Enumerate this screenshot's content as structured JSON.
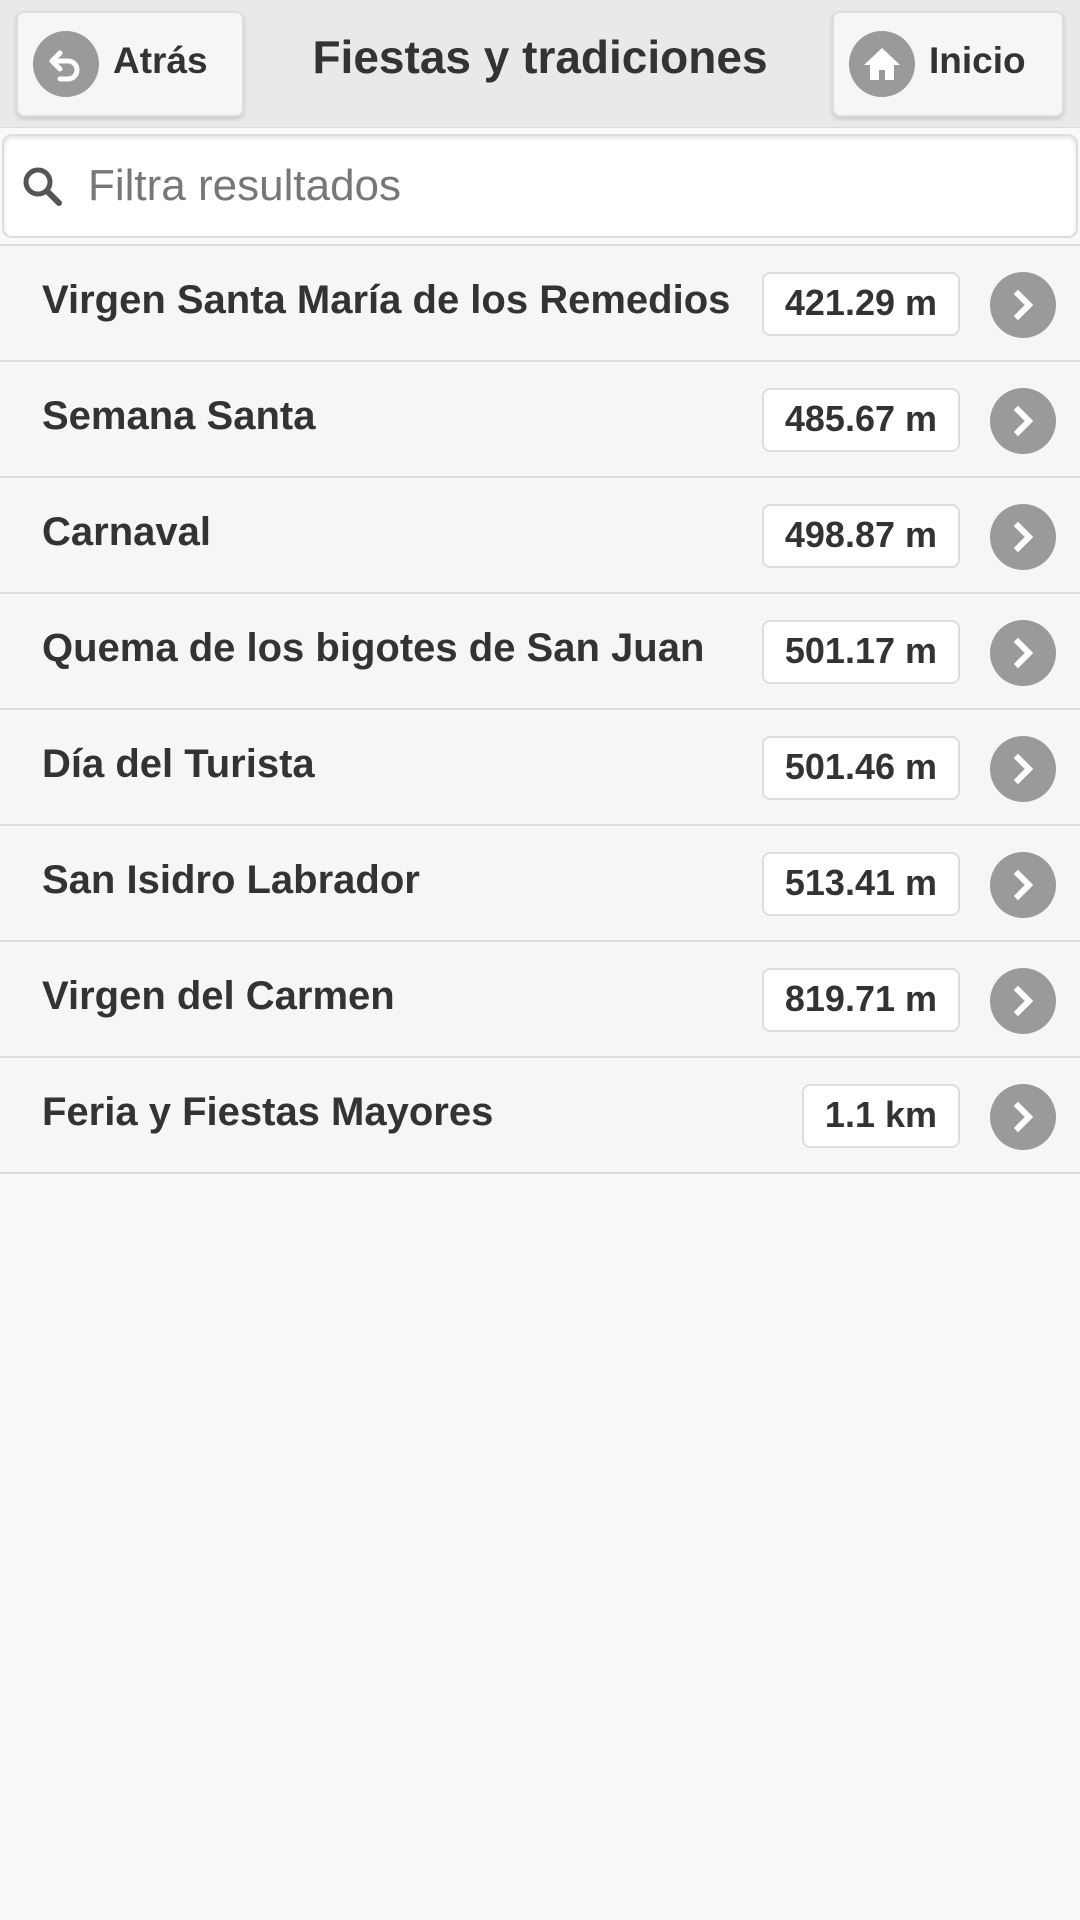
{
  "header": {
    "back_label": "Atrás",
    "title": "Fiestas y tradiciones",
    "home_label": "Inicio"
  },
  "search": {
    "placeholder": "Filtra resultados",
    "value": ""
  },
  "items": [
    {
      "label": "Virgen Santa María de los Remedios",
      "distance": "421.29 m"
    },
    {
      "label": "Semana Santa",
      "distance": "485.67 m"
    },
    {
      "label": "Carnaval",
      "distance": "498.87 m"
    },
    {
      "label": "Quema de los bigotes de San Juan",
      "distance": "501.17 m"
    },
    {
      "label": "Día del Turista",
      "distance": "501.46 m"
    },
    {
      "label": "San Isidro Labrador",
      "distance": "513.41 m"
    },
    {
      "label": "Virgen del Carmen",
      "distance": "819.71 m"
    },
    {
      "label": "Feria y Fiestas Mayores",
      "distance": "1.1 km"
    }
  ],
  "icons": {
    "back": "back-arrow-icon",
    "home": "home-icon",
    "search": "search-icon",
    "row": "chevron-right-icon"
  },
  "colors": {
    "icon_circle": "#9a9a9a",
    "header_bg": "#e9e9e9",
    "row_bg": "#f6f6f6",
    "text": "#333333"
  }
}
